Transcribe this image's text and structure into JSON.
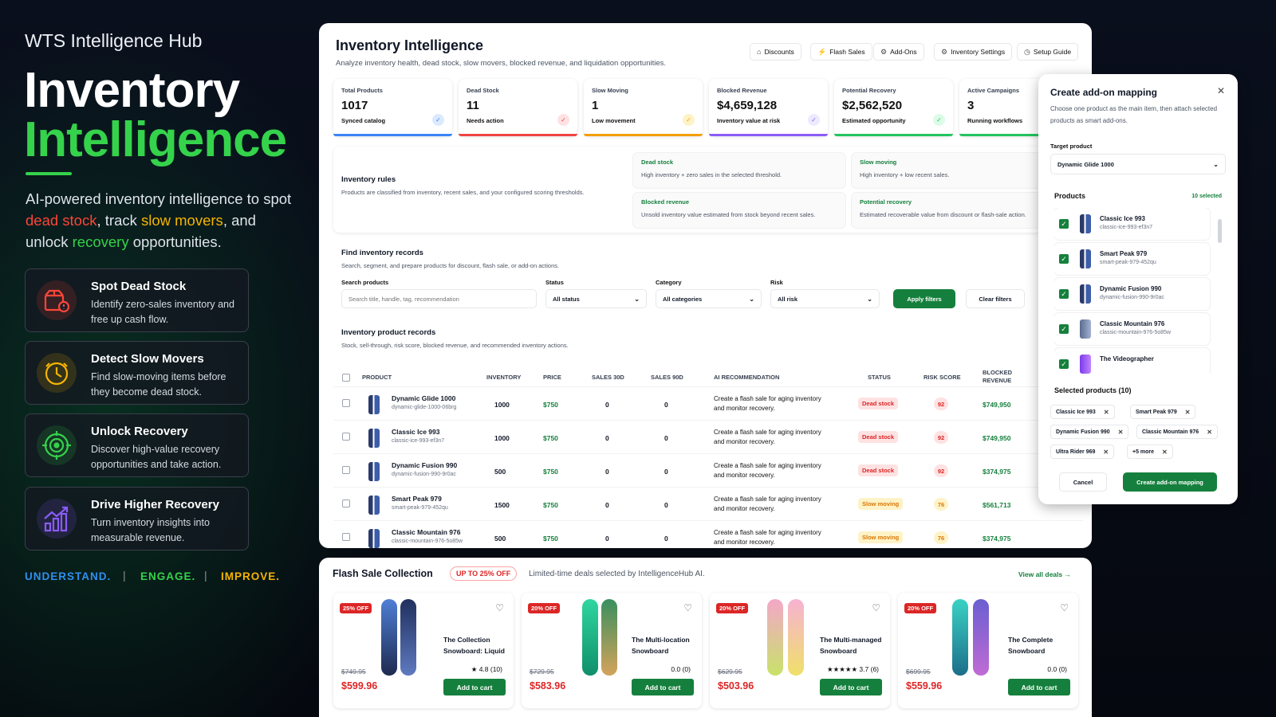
{
  "hero": {
    "hub": "WTS Intelligence Hub",
    "title1": "Inventory",
    "title2": "Intelligence",
    "desc": {
      "p1": "AI-powered inventory intelligence to spot ",
      "r": "dead stock",
      "p2": ", track ",
      "y": "slow movers",
      "p3": ", and unlock ",
      "g": "recovery",
      "p4": " opportunities."
    },
    "features": [
      {
        "title": "Spot Dead Stock",
        "desc": "Identify zero-sales inventory and free up cash flow.",
        "icon": "box-alert-icon",
        "color": "#ff4538"
      },
      {
        "title": "Detect Slow Movers",
        "desc": "Find slow-moving items before they become dead stock.",
        "icon": "clock-icon",
        "color": "#f5b400"
      },
      {
        "title": "Unlock Recovery",
        "desc": "Discover high-value recovery opportunities and take action.",
        "icon": "target-icon",
        "color": "#35d24b"
      },
      {
        "title": "Drive Higher Recovery",
        "desc": "Turn inventory insights into measurable revenue.",
        "icon": "growth-chart-icon",
        "color": "#8b5cf6"
      }
    ],
    "tags": [
      "UNDERSTAND.",
      "ENGAGE.",
      "IMPROVE."
    ],
    "tag_colors": [
      "#2f8ff0",
      "#35d24b",
      "#f5b400"
    ],
    "sep": "|"
  },
  "panel": {
    "title": "Inventory Intelligence",
    "subtitle": "Analyze inventory health, dead stock, slow movers, blocked revenue, and liquidation opportunities.",
    "top_buttons": [
      "Discounts",
      "Flash Sales",
      "Add-Ons",
      "Inventory Settings",
      "Setup Guide"
    ],
    "cards": [
      {
        "label": "Total Products",
        "value": "1017",
        "sub": "Synced catalog",
        "color": "#3b82f6"
      },
      {
        "label": "Dead Stock",
        "value": "11",
        "sub": "Needs action",
        "color": "#ef4444"
      },
      {
        "label": "Slow Moving",
        "value": "1",
        "sub": "Low movement",
        "color": "#f59e0b"
      },
      {
        "label": "Blocked Revenue",
        "value": "$4,659,128",
        "sub": "Inventory value at risk",
        "color": "#8b5cf6"
      },
      {
        "label": "Potential Recovery",
        "value": "$2,562,520",
        "sub": "Estimated opportunity",
        "color": "#22c55e"
      },
      {
        "label": "Active Campaigns",
        "value": "3",
        "sub": "Running workflows",
        "color": "#22c55e"
      }
    ],
    "rules": {
      "title": "Inventory rules",
      "desc": "Products are classified from inventory, recent sales, and your configured scoring thresholds.",
      "boxes": [
        {
          "t": "Dead stock",
          "d": "High inventory + zero sales in the selected threshold."
        },
        {
          "t": "Slow moving",
          "d": "High inventory + low recent sales."
        },
        {
          "t": "Blocked revenue",
          "d": "Unsold inventory value estimated from stock beyond recent sales."
        },
        {
          "t": "Potential recovery",
          "d": "Estimated recoverable value from discount or flash-sale action."
        }
      ]
    },
    "find": {
      "title": "Find inventory records",
      "desc": "Search, segment, and prepare products for discount, flash sale, or add-on actions.",
      "search_label": "Search products",
      "search_placeholder": "Search title, handle, tag, recommendation",
      "status_label": "Status",
      "status_value": "All status",
      "category_label": "Category",
      "category_value": "All categories",
      "risk_label": "Risk",
      "risk_value": "All risk",
      "apply": "Apply filters",
      "clear": "Clear filters"
    },
    "records": {
      "title": "Inventory product records",
      "desc": "Stock, sell-through, risk score, blocked revenue, and recommended inventory actions.",
      "headers": [
        "PRODUCT",
        "INVENTORY",
        "PRICE",
        "SALES 30D",
        "SALES 90D",
        "AI RECOMMENDATION",
        "STATUS",
        "RISK SCORE",
        "BLOCKED",
        "REVENUE"
      ],
      "rows": [
        {
          "name": "Dynamic Glide 1000",
          "handle": "dynamic-glide-1000-06brg",
          "inv": "1000",
          "price": "$750",
          "s30": "0",
          "s90": "0",
          "rec": "Create a flash sale for aging inventory and monitor recovery.",
          "status": "Dead stock",
          "risk": "92",
          "blocked": "$749,950"
        },
        {
          "name": "Classic Ice 993",
          "handle": "classic-ice-993-ef3n7",
          "inv": "1000",
          "price": "$750",
          "s30": "0",
          "s90": "0",
          "rec": "Create a flash sale for aging inventory and monitor recovery.",
          "status": "Dead stock",
          "risk": "92",
          "blocked": "$749,950"
        },
        {
          "name": "Dynamic Fusion 990",
          "handle": "dynamic-fusion-990-9r0ac",
          "inv": "500",
          "price": "$750",
          "s30": "0",
          "s90": "0",
          "rec": "Create a flash sale for aging inventory and monitor recovery.",
          "status": "Dead stock",
          "risk": "92",
          "blocked": "$374,975"
        },
        {
          "name": "Smart Peak 979",
          "handle": "smart-peak-979-452qu",
          "inv": "1500",
          "price": "$750",
          "s30": "0",
          "s90": "0",
          "rec": "Create a flash sale for aging inventory and monitor recovery.",
          "status": "Slow moving",
          "risk": "76",
          "blocked": "$561,713"
        },
        {
          "name": "Classic Mountain 976",
          "handle": "classic-mountain-976-5o85w",
          "inv": "500",
          "price": "$750",
          "s30": "0",
          "s90": "0",
          "rec": "Create a flash sale for aging inventory and monitor recovery.",
          "status": "Slow moving",
          "risk": "76",
          "blocked": "$374,975"
        }
      ]
    }
  },
  "drawer": {
    "title": "Create add-on mapping",
    "desc": "Choose one product as the main item, then attach selected products as smart add-ons.",
    "target_label": "Target product",
    "target_value": "Dynamic Glide 1000",
    "products_label": "Products",
    "selected_count": "10 selected",
    "items": [
      {
        "name": "Classic Ice 993",
        "handle": "classic-ice-993-ef3n7"
      },
      {
        "name": "Smart Peak 979",
        "handle": "smart-peak-979-452qu"
      },
      {
        "name": "Dynamic Fusion 990",
        "handle": "dynamic-fusion-990-9r0ac"
      },
      {
        "name": "Classic Mountain 976",
        "handle": "classic-mountain-976-5o85w"
      },
      {
        "name": "The Videographer",
        "handle": ""
      }
    ],
    "selected_title": "Selected products (10)",
    "chips": [
      "Classic Ice 993",
      "Smart Peak 979",
      "Dynamic Fusion 990",
      "Classic Mountain 976",
      "Ultra Rider 969",
      "+5 more"
    ],
    "cancel": "Cancel",
    "create": "Create add-on mapping"
  },
  "flash": {
    "title": "Flash Sale Collection",
    "badge": "UP TO 25% OFF",
    "desc": "Limited-time deals selected by IntelligenceHub AI.",
    "view_all": "View all deals →",
    "products": [
      {
        "off": "25% OFF",
        "name": "The Collection Snowboard: Liquid",
        "rating": "★ 4.8 (10)",
        "old": "$749.95",
        "new": "$599.96",
        "btn": "Add to cart"
      },
      {
        "off": "20% OFF",
        "name": "The Multi-location Snowboard",
        "rating": "0.0 (0)",
        "old": "$729.95",
        "new": "$583.96",
        "btn": "Add to cart"
      },
      {
        "off": "20% OFF",
        "name": "The Multi-managed Snowboard",
        "rating": "★★★★★ 3.7 (6)",
        "old": "$629.95",
        "new": "$503.96",
        "btn": "Add to cart"
      },
      {
        "off": "20% OFF",
        "name": "The Complete Snowboard",
        "rating": "0.0 (0)",
        "old": "$699.95",
        "new": "$559.96",
        "btn": "Add to cart"
      }
    ]
  }
}
